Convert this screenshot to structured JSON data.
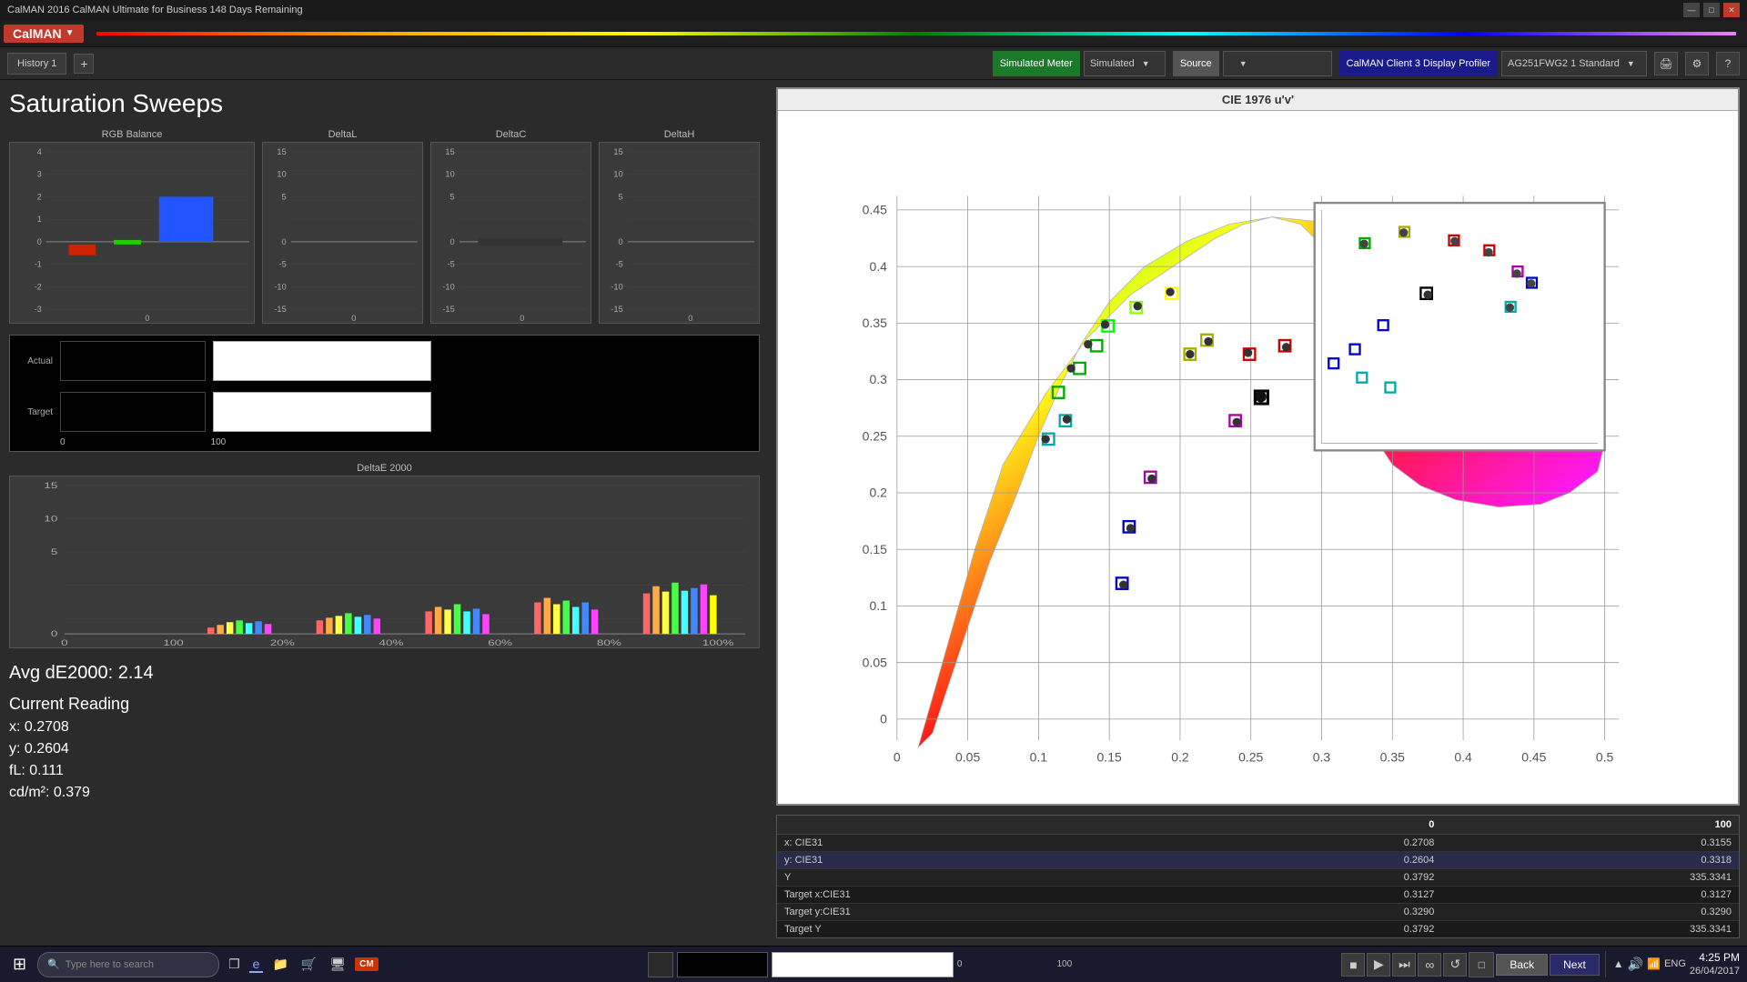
{
  "window": {
    "title": "CalMAN 2016 CalMAN Ultimate for Business 148 Days Remaining",
    "controls": [
      "—",
      "□",
      "✕"
    ]
  },
  "menubar": {
    "logo": "CalMAN",
    "logo_arrow": "▼"
  },
  "toolbar": {
    "history_tab": "History 1",
    "add_tab": "+",
    "simulated_meter_label": "Simulated Meter",
    "simulated_meter_value": "Simulated",
    "source_label": "Source",
    "profiler_label": "CalMAN Client 3 Display Profiler",
    "profiler_value": "AG251FWG2 1 Standard"
  },
  "main": {
    "section_title": "Saturation Sweeps",
    "avg_de2000": "Avg dE2000: 2.14",
    "current_reading": "Current Reading",
    "x_val": "x: 0.2708",
    "y_val": "y: 0.2604",
    "fl_val": "fL: 0.111",
    "cd_val": "cd/m²: 0.379"
  },
  "charts": {
    "rgb_balance": "RGB Balance",
    "delta_l": "DeltaL",
    "delta_c": "DeltaC",
    "delta_h": "DeltaH",
    "delta_e2000": "DeltaE 2000",
    "cie_chart": "CIE 1976 u'v'"
  },
  "swatch_labels": {
    "actual": "Actual",
    "target": "Target",
    "x0": "0",
    "x100": "100"
  },
  "deltae_x_labels": [
    "0",
    "100",
    "20%",
    "40%",
    "60%",
    "80%",
    "100%"
  ],
  "data_table": {
    "header": [
      "",
      "0",
      "100"
    ],
    "rows": [
      {
        "label": "x: CIE31",
        "col1": "0.2708",
        "col2": "0.3155"
      },
      {
        "label": "y: CIE31",
        "col1": "0.2604",
        "col2": "0.3318"
      },
      {
        "label": "Y",
        "col1": "",
        "col2": "0.3792",
        "col3": "335.3341"
      },
      {
        "label": "Target x:CIE31",
        "col1": "0.3127",
        "col2": "0.3127"
      },
      {
        "label": "Target y:CIE31",
        "col1": "0.3290",
        "col2": "0.3290"
      },
      {
        "label": "Target Y",
        "col1": "0.3792",
        "col2": "335.3341"
      }
    ]
  },
  "navigation": {
    "back": "Back",
    "next": "Next"
  },
  "taskbar_bottom": {
    "swatch0_label": "0",
    "swatch100_label": "100",
    "time": "4:25 PM",
    "date": "26/04/2017",
    "lang": "ENG"
  },
  "icons": {
    "windows_start": "⊞",
    "search_placeholder": "Type here to search",
    "cortana": "🔍",
    "task_view": "❐",
    "ie": "e",
    "folder": "📁",
    "store": "🛍",
    "steam": "♨",
    "calman": "CM",
    "sound": "🔊",
    "network": "📶",
    "arrow_up": "▲",
    "arrow_down": "▼"
  }
}
